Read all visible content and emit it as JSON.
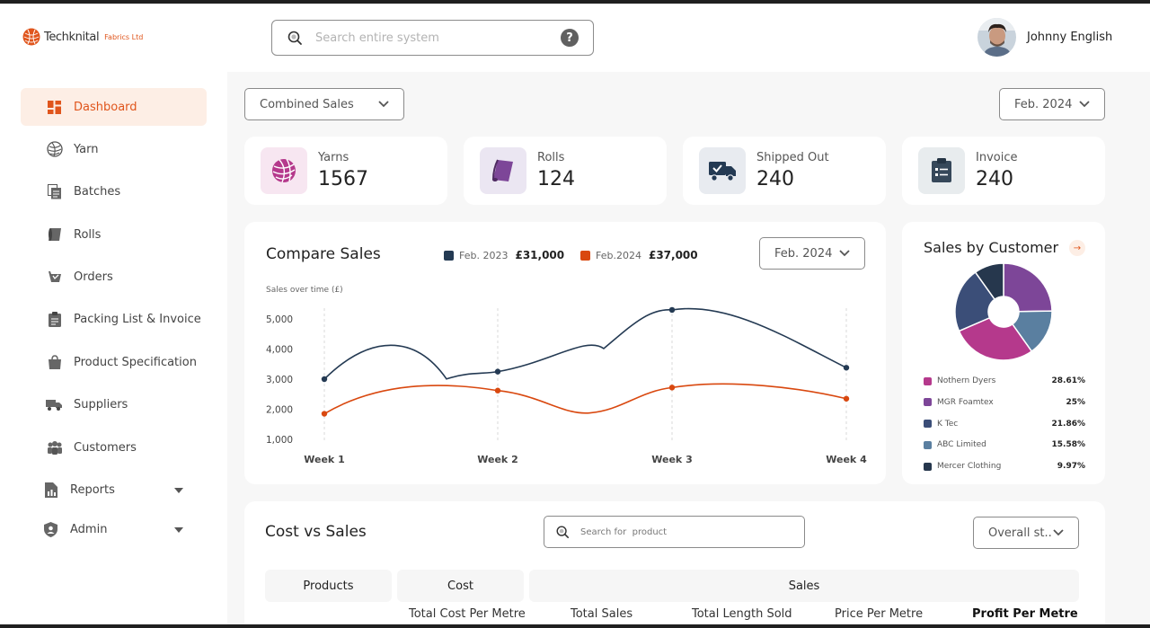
{
  "brand": {
    "name": "Techknital",
    "suffix": "Fabrics Ltd"
  },
  "search": {
    "placeholder": "Search entire system",
    "help": "?"
  },
  "user": {
    "name": "Johnny English"
  },
  "sidebar": {
    "items": [
      {
        "label": "Dashboard",
        "icon": "dashboard-icon",
        "active": true
      },
      {
        "label": "Yarn",
        "icon": "yarn-icon"
      },
      {
        "label": "Batches",
        "icon": "batches-icon"
      },
      {
        "label": "Rolls",
        "icon": "rolls-icon"
      },
      {
        "label": "Orders",
        "icon": "orders-icon"
      },
      {
        "label": "Packing List & Invoice",
        "icon": "clipboard-icon"
      },
      {
        "label": "Product Specification",
        "icon": "bag-icon"
      },
      {
        "label": "Suppliers",
        "icon": "truck-icon"
      },
      {
        "label": "Customers",
        "icon": "people-icon"
      },
      {
        "label": "Reports",
        "icon": "report-icon"
      },
      {
        "label": "Admin",
        "icon": "shield-icon"
      }
    ]
  },
  "filters": {
    "sales_type": "Combined Sales",
    "period": "Feb. 2024"
  },
  "stats": [
    {
      "label": "Yarns",
      "value": "1567"
    },
    {
      "label": "Rolls",
      "value": "124"
    },
    {
      "label": "Shipped Out",
      "value": "240"
    },
    {
      "label": "Invoice",
      "value": "240"
    }
  ],
  "compare": {
    "title": "Compare Sales",
    "period": "Feb. 2024",
    "legend": [
      {
        "label": "Feb. 2023",
        "value": "£31,000",
        "color": "#243a53"
      },
      {
        "label": "Feb.2024",
        "value": "£37,000",
        "color": "#d9480f"
      }
    ]
  },
  "chart_data": {
    "type": "line",
    "ylabel": "Sales over time (£)",
    "categories": [
      "Week 1",
      "Week 2",
      "Week 3",
      "Week 4"
    ],
    "y_ticks": [
      "5,000",
      "4,000",
      "3,000",
      "2,000",
      "1,000"
    ],
    "ylim": [
      1000,
      5000
    ],
    "grid": "vertical dashed",
    "series": [
      {
        "name": "Feb. 2023",
        "color": "#243a53",
        "values": [
          3000,
          3250,
          5300,
          3380
        ],
        "peak_between_1_2": 4200,
        "peak_near_3": 5360
      },
      {
        "name": "Feb.2024",
        "color": "#d9480f",
        "values": [
          1850,
          2620,
          2720,
          2350
        ],
        "dip_between_2_3": 1880
      }
    ]
  },
  "customers": {
    "title": "Sales by Customer",
    "arrow": "→",
    "items": [
      {
        "name": "Nothern Dyers",
        "pct": "28.61%",
        "value": 28.61,
        "color": "#b5398c"
      },
      {
        "name": "MGR Foamtex",
        "pct": "25%",
        "value": 25,
        "color": "#7d4698"
      },
      {
        "name": "K Tec",
        "pct": "21.86%",
        "value": 21.86,
        "color": "#3b4e78"
      },
      {
        "name": "ABC Limited",
        "pct": "15.58%",
        "value": 15.58,
        "color": "#5a7fa0"
      },
      {
        "name": "Mercer Clothing",
        "pct": "9.97%",
        "value": 9.97,
        "color": "#26374d"
      }
    ]
  },
  "cost_sales": {
    "title": "Cost vs Sales",
    "search_placeholder": "Search for  product",
    "status": "Overall st..",
    "headers": {
      "products": "Products",
      "cost": "Cost",
      "sales": "Sales"
    },
    "subheaders": [
      "Total Cost Per Metre",
      "Total Sales",
      "Total Length Sold",
      "Price Per Metre",
      "Profit Per Metre"
    ]
  }
}
